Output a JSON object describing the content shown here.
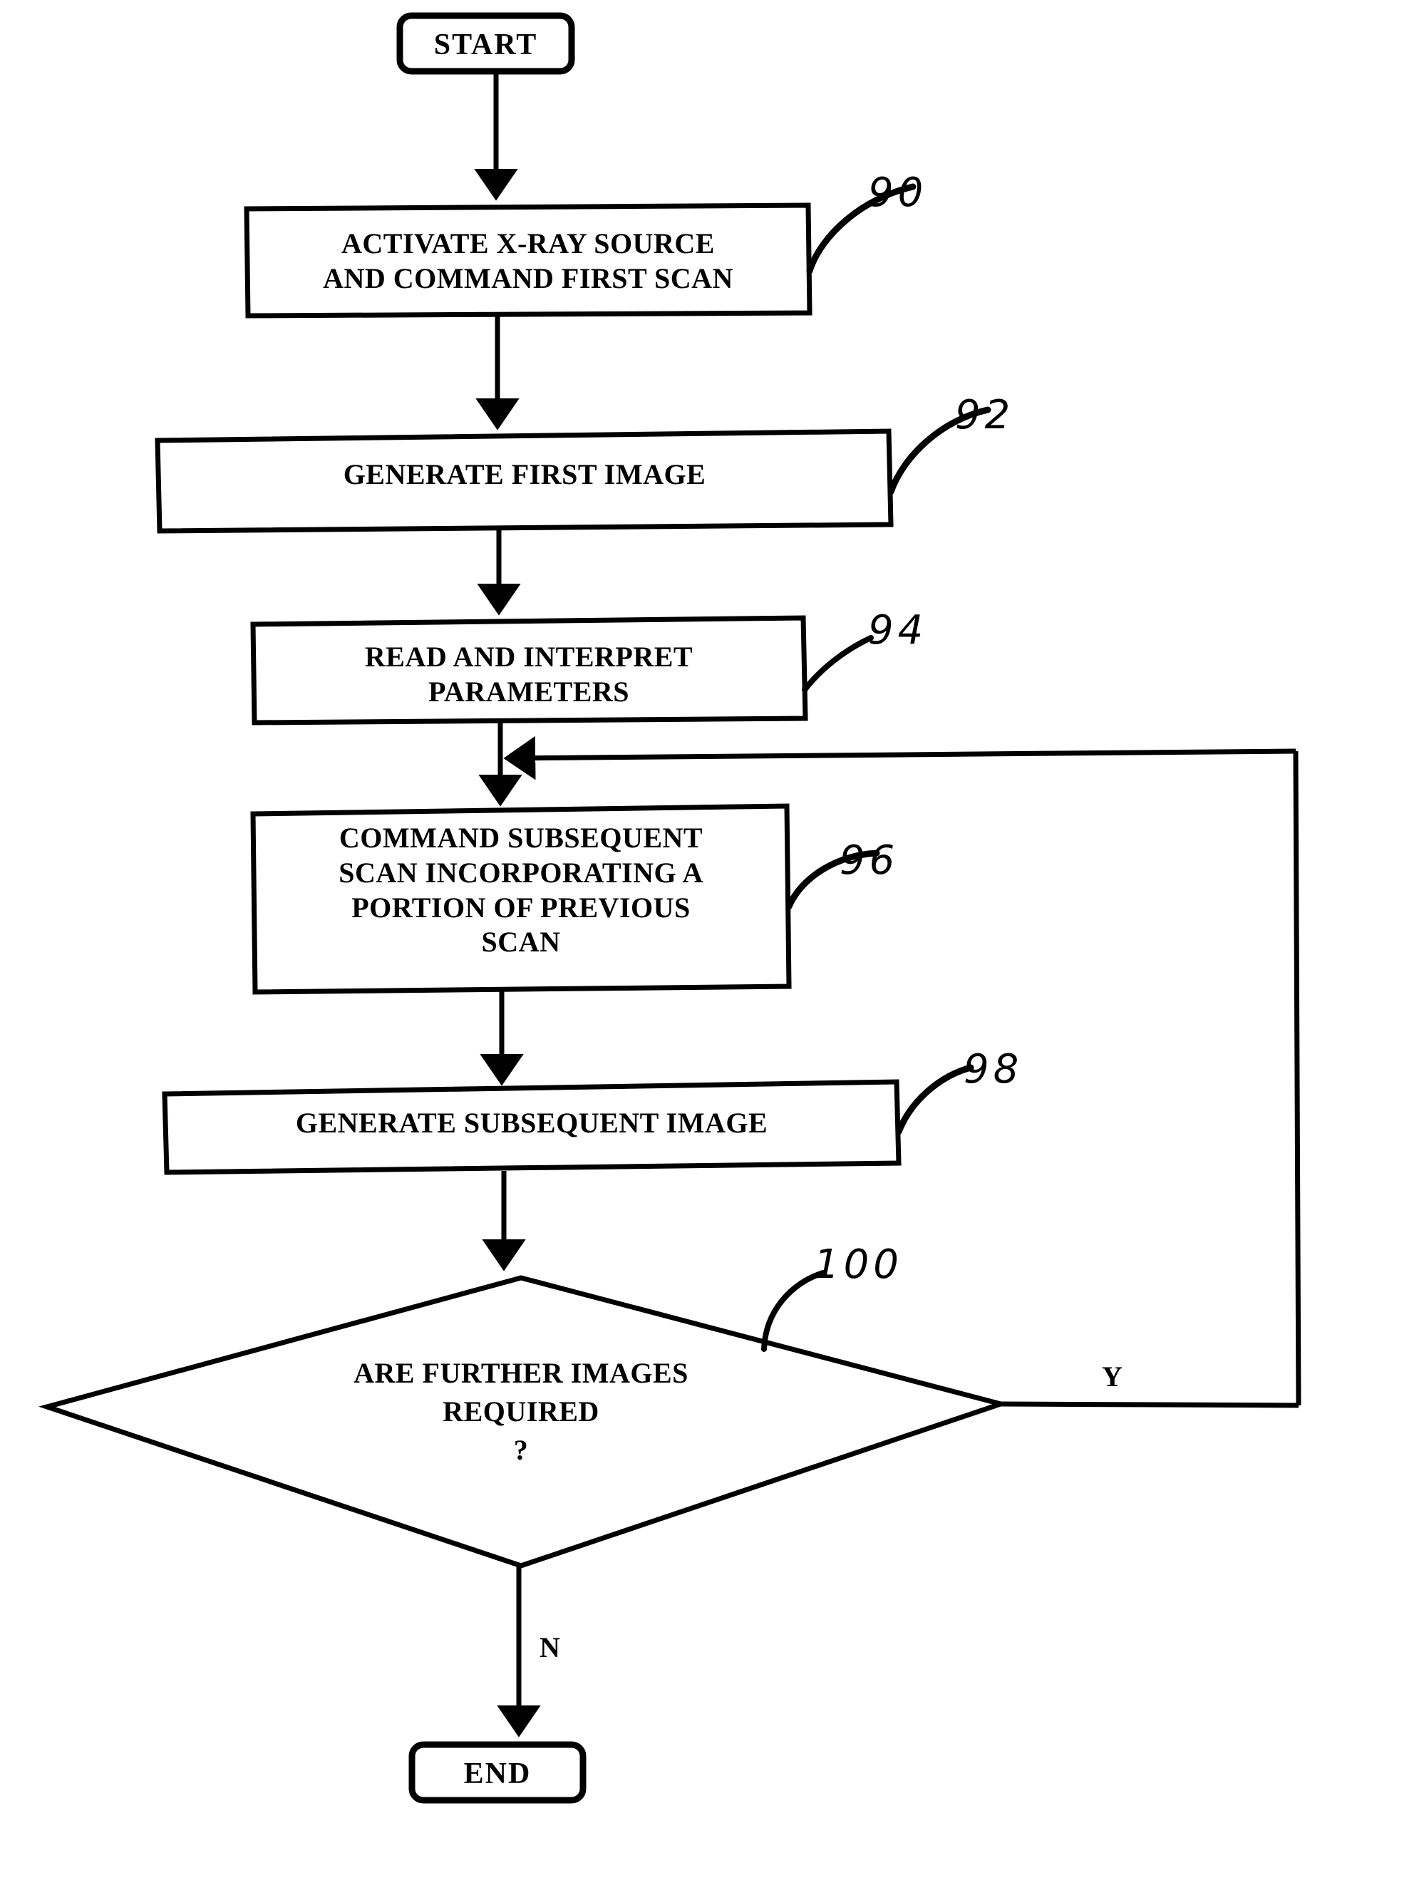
{
  "figure": {
    "type": "flowchart",
    "title": "X-ray scan image generation process flow",
    "background_color": "#ffffff",
    "line_color": "#000000"
  },
  "nodes": [
    {
      "id": "start",
      "shape": "rounded-rectangle",
      "label": "START",
      "ref": null
    },
    {
      "id": "activate",
      "shape": "rectangle",
      "label": "ACTIVATE X-RAY SOURCE\nAND COMMAND FIRST SCAN",
      "ref": "90"
    },
    {
      "id": "generate-first",
      "shape": "rectangle",
      "label": "GENERATE FIRST IMAGE",
      "ref": "92"
    },
    {
      "id": "read-params",
      "shape": "rectangle",
      "label": "READ AND INTERPRET\nPARAMETERS",
      "ref": "94"
    },
    {
      "id": "command-subsequent",
      "shape": "rectangle",
      "label": "COMMAND SUBSEQUENT\nSCAN INCORPORATING A\nPORTION OF PREVIOUS\nSCAN",
      "ref": "96"
    },
    {
      "id": "generate-subsequent",
      "shape": "rectangle",
      "label": "GENERATE SUBSEQUENT IMAGE",
      "ref": "98"
    },
    {
      "id": "decision",
      "shape": "diamond",
      "label": "ARE FURTHER IMAGES\nREQUIRED\n?",
      "ref": "100"
    },
    {
      "id": "end",
      "shape": "rounded-rectangle",
      "label": "END",
      "ref": null
    }
  ],
  "edges": [
    {
      "id": "e-start-activate",
      "from": "start",
      "to": "activate",
      "label": ""
    },
    {
      "id": "e-activate-generate-first",
      "from": "activate",
      "to": "generate-first",
      "label": ""
    },
    {
      "id": "e-generate-first-read",
      "from": "generate-first",
      "to": "read-params",
      "label": ""
    },
    {
      "id": "e-read-command",
      "from": "read-params",
      "to": "command-subsequent",
      "label": ""
    },
    {
      "id": "e-command-generate",
      "from": "command-subsequent",
      "to": "generate-subsequent",
      "label": ""
    },
    {
      "id": "e-generate-decision",
      "from": "generate-subsequent",
      "to": "decision",
      "label": ""
    },
    {
      "id": "e-decision-yes",
      "from": "decision",
      "to": "command-subsequent",
      "label": "Y"
    },
    {
      "id": "e-decision-no",
      "from": "decision",
      "to": "end",
      "label": "N"
    }
  ],
  "branch_labels": {
    "yes": "Y",
    "no": "N"
  },
  "reference_numerals": {
    "activate": "90",
    "generate_first": "92",
    "read_params": "94",
    "command_subsequent": "96",
    "generate_subsequent": "98",
    "decision": "100"
  }
}
